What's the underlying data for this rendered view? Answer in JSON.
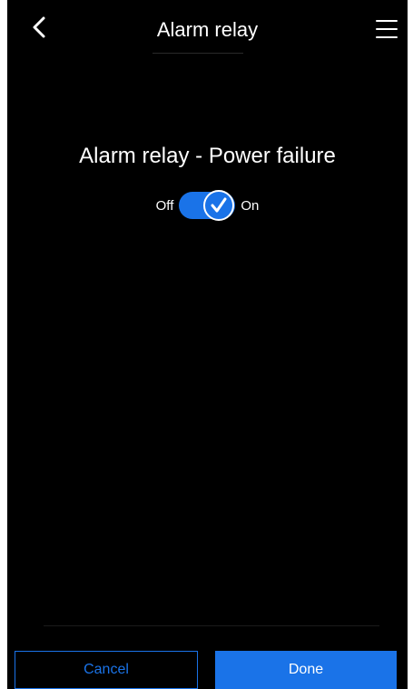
{
  "header": {
    "title": "Alarm relay",
    "back_icon": "chevron-left-icon",
    "menu_icon": "hamburger-menu-icon"
  },
  "setting": {
    "title": "Alarm relay - Power failure",
    "off_label": "Off",
    "on_label": "On",
    "state": "on"
  },
  "footer": {
    "cancel_label": "Cancel",
    "done_label": "Done"
  },
  "colors": {
    "background": "#000000",
    "accent": "#1a73e8",
    "text": "#ffffff"
  }
}
